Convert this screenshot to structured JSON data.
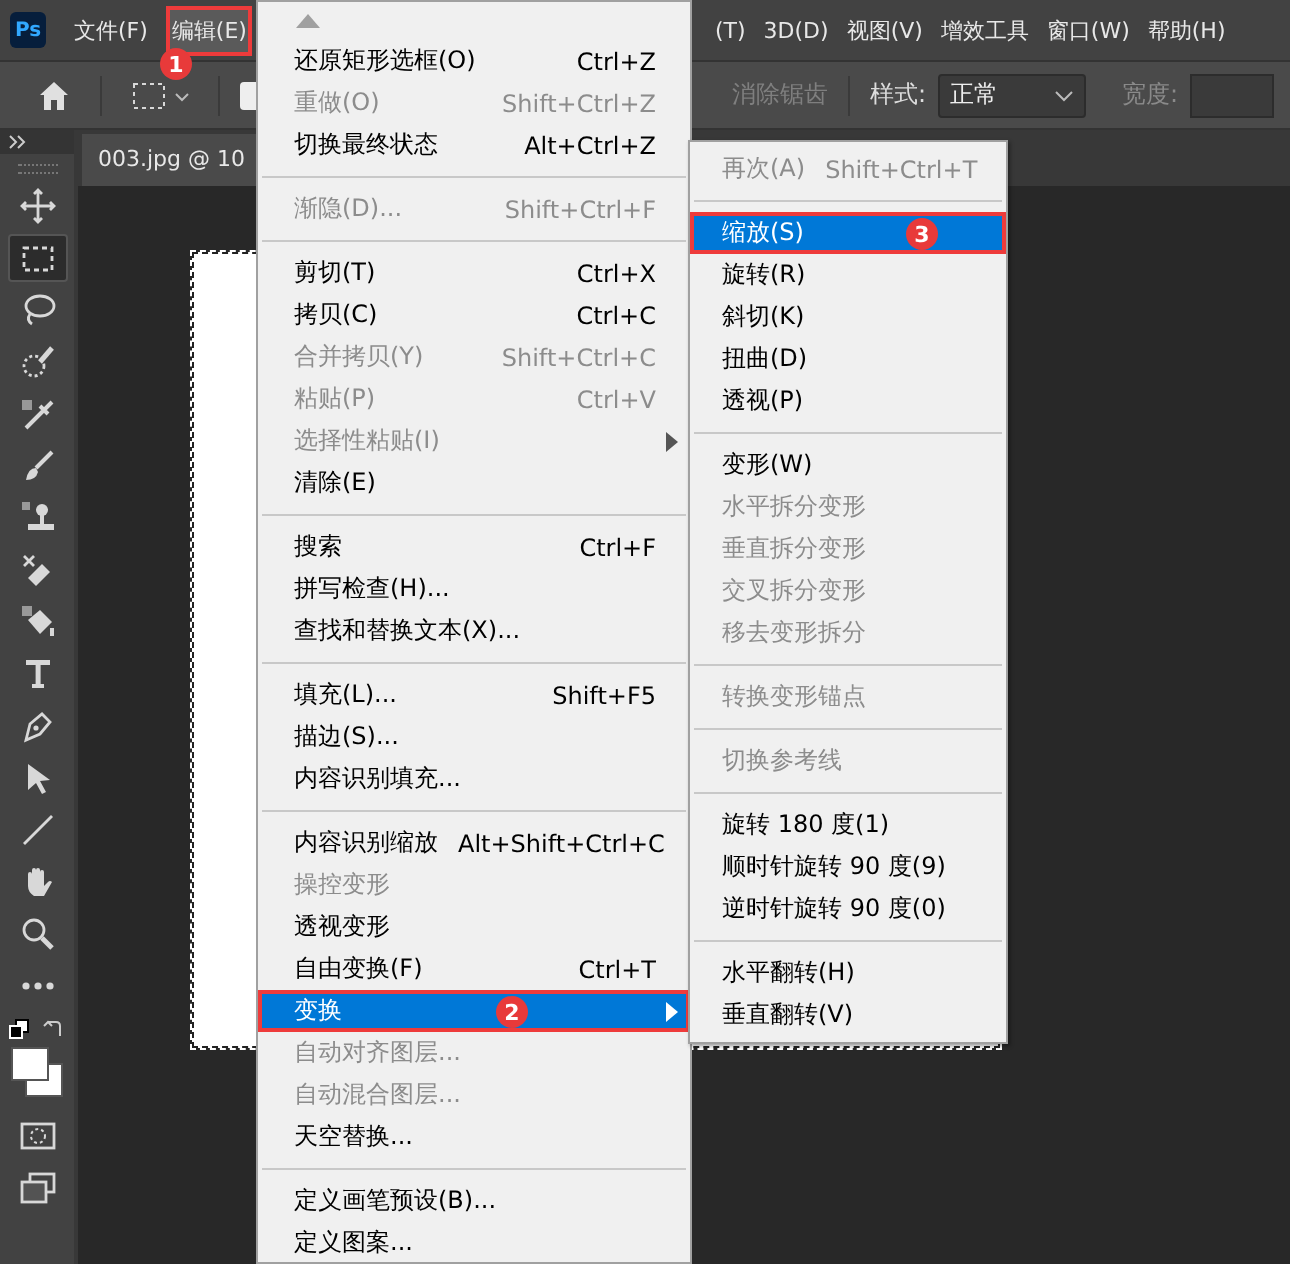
{
  "app_logo": "Ps",
  "menu_bar": [
    {
      "label": "文件(F)",
      "selected": false
    },
    {
      "label": "编辑(E)",
      "selected": true,
      "callout": "1"
    },
    {
      "label": "(T)",
      "selected": false
    },
    {
      "label": "3D(D)",
      "selected": false
    },
    {
      "label": "视图(V)",
      "selected": false
    },
    {
      "label": "增效工具",
      "selected": false
    },
    {
      "label": "窗口(W)",
      "selected": false
    },
    {
      "label": "帮助(H)",
      "selected": false
    }
  ],
  "options_bar": {
    "antialias": {
      "label": "消除锯齿",
      "disabled": true
    },
    "style_label": "样式:",
    "style_value": "正常",
    "width_label": "宽度:"
  },
  "document_tab": "003.jpg @ 10",
  "tools": [
    {
      "kind": "move",
      "selected": false
    },
    {
      "kind": "marquee",
      "selected": true
    },
    {
      "kind": "lasso",
      "selected": false
    },
    {
      "kind": "quick-select",
      "selected": false
    },
    {
      "kind": "eyedropper",
      "selected": false
    },
    {
      "kind": "brush",
      "selected": false
    },
    {
      "kind": "stamp",
      "selected": false
    },
    {
      "kind": "eraser",
      "selected": false
    },
    {
      "kind": "bucket",
      "selected": false
    },
    {
      "kind": "type",
      "selected": false
    },
    {
      "kind": "pen",
      "selected": false
    },
    {
      "kind": "path-select",
      "selected": false
    },
    {
      "kind": "line",
      "selected": false
    },
    {
      "kind": "hand",
      "selected": false
    },
    {
      "kind": "zoom",
      "selected": false
    },
    {
      "kind": "more",
      "selected": false
    },
    {
      "kind": "swatches",
      "selected": false
    },
    {
      "kind": "quick-mask",
      "selected": false
    },
    {
      "kind": "screen-mode",
      "selected": false
    }
  ],
  "edit_menu": {
    "items": [
      {
        "kind": "item",
        "label": "还原矩形选框(O)",
        "shortcut": "Ctrl+Z",
        "disabled": false,
        "selected": false
      },
      {
        "kind": "item",
        "label": "重做(O)",
        "shortcut": "Shift+Ctrl+Z",
        "disabled": true,
        "selected": false
      },
      {
        "kind": "item",
        "label": "切换最终状态",
        "shortcut": "Alt+Ctrl+Z",
        "disabled": false,
        "selected": false
      },
      {
        "kind": "separator"
      },
      {
        "kind": "item",
        "label": "渐隐(D)...",
        "shortcut": "Shift+Ctrl+F",
        "disabled": true,
        "selected": false
      },
      {
        "kind": "separator"
      },
      {
        "kind": "item",
        "label": "剪切(T)",
        "shortcut": "Ctrl+X",
        "disabled": false,
        "selected": false
      },
      {
        "kind": "item",
        "label": "拷贝(C)",
        "shortcut": "Ctrl+C",
        "disabled": false,
        "selected": false
      },
      {
        "kind": "item",
        "label": "合并拷贝(Y)",
        "shortcut": "Shift+Ctrl+C",
        "disabled": true,
        "selected": false
      },
      {
        "kind": "item",
        "label": "粘贴(P)",
        "shortcut": "Ctrl+V",
        "disabled": true,
        "selected": false
      },
      {
        "kind": "item",
        "label": "选择性粘贴(I)",
        "disabled": true,
        "selected": false,
        "submenu": true
      },
      {
        "kind": "item",
        "label": "清除(E)",
        "disabled": false,
        "selected": false
      },
      {
        "kind": "separator"
      },
      {
        "kind": "item",
        "label": "搜索",
        "shortcut": "Ctrl+F",
        "disabled": false,
        "selected": false
      },
      {
        "kind": "item",
        "label": "拼写检查(H)...",
        "disabled": false,
        "selected": false
      },
      {
        "kind": "item",
        "label": "查找和替换文本(X)...",
        "disabled": false,
        "selected": false
      },
      {
        "kind": "separator"
      },
      {
        "kind": "item",
        "label": "填充(L)...",
        "shortcut": "Shift+F5",
        "disabled": false,
        "selected": false
      },
      {
        "kind": "item",
        "label": "描边(S)...",
        "disabled": false,
        "selected": false
      },
      {
        "kind": "item",
        "label": "内容识别填充...",
        "disabled": false,
        "selected": false
      },
      {
        "kind": "separator"
      },
      {
        "kind": "item",
        "label": "内容识别缩放",
        "shortcut": "Alt+Shift+Ctrl+C",
        "disabled": false,
        "selected": false
      },
      {
        "kind": "item",
        "label": "操控变形",
        "disabled": true,
        "selected": false
      },
      {
        "kind": "item",
        "label": "透视变形",
        "disabled": false,
        "selected": false
      },
      {
        "kind": "item",
        "label": "自由变换(F)",
        "shortcut": "Ctrl+T",
        "disabled": false,
        "selected": false
      },
      {
        "kind": "item",
        "label": "变换",
        "disabled": false,
        "selected": true,
        "submenu": true,
        "callout": "2"
      },
      {
        "kind": "item",
        "label": "自动对齐图层...",
        "disabled": true,
        "selected": false
      },
      {
        "kind": "item",
        "label": "自动混合图层...",
        "disabled": true,
        "selected": false
      },
      {
        "kind": "item",
        "label": "天空替换...",
        "disabled": false,
        "selected": false
      },
      {
        "kind": "separator"
      },
      {
        "kind": "item",
        "label": "定义画笔预设(B)...",
        "disabled": false,
        "selected": false
      },
      {
        "kind": "item",
        "label": "定义图案...",
        "disabled": false,
        "selected": false
      }
    ]
  },
  "transform_submenu": {
    "items": [
      {
        "kind": "item",
        "label": "再次(A)",
        "shortcut": "Shift+Ctrl+T",
        "disabled": true,
        "selected": false
      },
      {
        "kind": "separator"
      },
      {
        "kind": "item",
        "label": "缩放(S)",
        "disabled": false,
        "selected": true,
        "callout": "3"
      },
      {
        "kind": "item",
        "label": "旋转(R)",
        "disabled": false,
        "selected": false
      },
      {
        "kind": "item",
        "label": "斜切(K)",
        "disabled": false,
        "selected": false
      },
      {
        "kind": "item",
        "label": "扭曲(D)",
        "disabled": false,
        "selected": false
      },
      {
        "kind": "item",
        "label": "透视(P)",
        "disabled": false,
        "selected": false
      },
      {
        "kind": "separator"
      },
      {
        "kind": "item",
        "label": "变形(W)",
        "disabled": false,
        "selected": false
      },
      {
        "kind": "item",
        "label": "水平拆分变形",
        "disabled": true,
        "selected": false
      },
      {
        "kind": "item",
        "label": "垂直拆分变形",
        "disabled": true,
        "selected": false
      },
      {
        "kind": "item",
        "label": "交叉拆分变形",
        "disabled": true,
        "selected": false
      },
      {
        "kind": "item",
        "label": "移去变形拆分",
        "disabled": true,
        "selected": false
      },
      {
        "kind": "separator"
      },
      {
        "kind": "item",
        "label": "转换变形锚点",
        "disabled": true,
        "selected": false
      },
      {
        "kind": "separator"
      },
      {
        "kind": "item",
        "label": "切换参考线",
        "disabled": true,
        "selected": false
      },
      {
        "kind": "separator"
      },
      {
        "kind": "item",
        "label": "旋转 180 度(1)",
        "disabled": false,
        "selected": false
      },
      {
        "kind": "item",
        "label": "顺时针旋转 90 度(9)",
        "disabled": false,
        "selected": false
      },
      {
        "kind": "item",
        "label": "逆时针旋转 90 度(0)",
        "disabled": false,
        "selected": false
      },
      {
        "kind": "separator"
      },
      {
        "kind": "item",
        "label": "水平翻转(H)",
        "disabled": false,
        "selected": false
      },
      {
        "kind": "item",
        "label": "垂直翻转(V)",
        "disabled": false,
        "selected": false
      }
    ]
  }
}
